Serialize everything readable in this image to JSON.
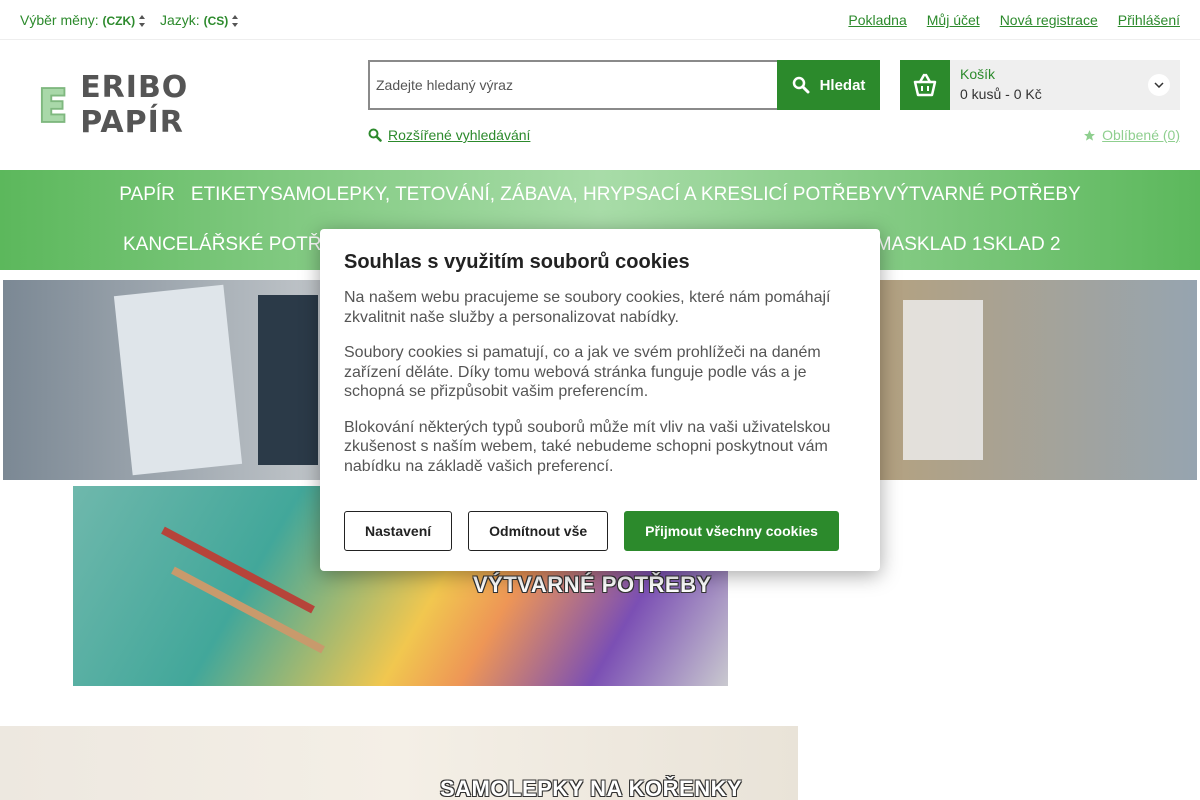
{
  "colors": {
    "brand_green": "#2c8a2c",
    "nav_green": "#5cb85c",
    "fav_green": "#8fcf8f"
  },
  "topbar": {
    "currency_label": "Výběr měny:",
    "currency_value": "(CZK)",
    "language_label": "Jazyk:",
    "language_value": "(CS)",
    "links": [
      "Pokladna",
      "Můj účet",
      "Nová registrace",
      "Přihlášení"
    ]
  },
  "header": {
    "logo_text": "ERIBO PAPÍR",
    "search": {
      "placeholder": "Zadejte hledaný výraz",
      "button": "Hledat"
    },
    "advanced_search": "Rozšířené vyhledávání",
    "cart": {
      "label": "Košík",
      "summary": "0 kusů - 0 Kč"
    },
    "favorites": "Oblíbené (0)"
  },
  "nav": {
    "row1": [
      "PAPÍR",
      "ETIKETY",
      "SAMOLEPKY, TETOVÁNÍ, ZÁBAVA, HRYPSACÍ A KRESLICÍ POTŘEBY",
      "VÝTVARNÉ POTŘEBY"
    ],
    "row2_left": "KANCELÁŘSKÉ POTŘ",
    "row2_right": [
      "RMA",
      "SKLAD 1",
      "SKLAD 2"
    ]
  },
  "banners": {
    "b2_title": "VÝTVARNÉ POTŘEBY",
    "b3_title": "SAMOLEPKY NA KOŘENKY"
  },
  "cookie": {
    "title": "Souhlas s využitím souborů cookies",
    "p1": "Na našem webu pracujeme se soubory cookies, které nám pomáhají zkvalitnit naše služby a personalizovat nabídky.",
    "p2": "Soubory cookies si pamatují, co a jak ve svém prohlížeči na daném zařízení děláte. Díky tomu webová stránka funguje podle vás a je schopná se přizpůsobit vašim preferencím.",
    "p3": "Blokování některých typů souborů může mít vliv na vaši uživatelskou zkušenost s naším webem, také nebudeme schopni poskytnout vám nabídku na základě vašich preferencí.",
    "btn_settings": "Nastavení",
    "btn_reject": "Odmítnout vše",
    "btn_accept": "Přijmout všechny cookies"
  }
}
